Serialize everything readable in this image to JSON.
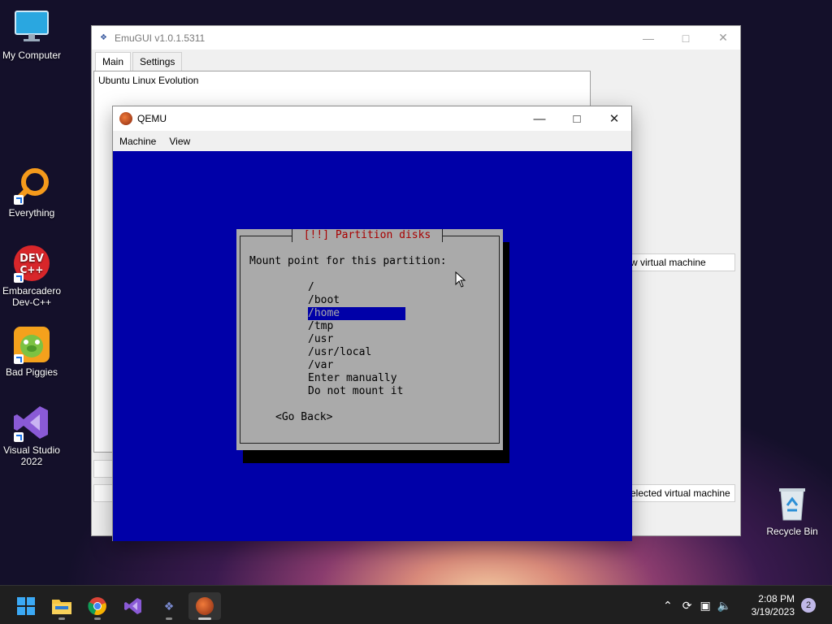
{
  "desktop": {
    "icons": [
      {
        "label": "My Computer"
      },
      {
        "label": "Everything"
      },
      {
        "label": "Embarcadero Dev-C++"
      },
      {
        "label": "Bad Piggies"
      },
      {
        "label": "Visual Studio 2022"
      },
      {
        "label": "Recycle Bin"
      }
    ]
  },
  "emugui": {
    "title": "EmuGUI v1.0.1.5311",
    "tabs": [
      "Main",
      "Settings"
    ],
    "vm_list": [
      "Ubuntu Linux Evolution"
    ],
    "buttons": {
      "new_vm": "w virtual machine",
      "selected_vm": "elected virtual machine"
    }
  },
  "qemu": {
    "title": "QEMU",
    "menu": [
      "Machine",
      "View"
    ],
    "installer": {
      "title": "[!!] Partition disks",
      "prompt": "Mount point for this partition:",
      "options": [
        "/",
        "/boot",
        "/home",
        "/tmp",
        "/usr",
        "/usr/local",
        "/var",
        "Enter manually",
        "Do not mount it"
      ],
      "selected_index": 2,
      "go_back": "<Go Back>"
    }
  },
  "taskbar": {
    "time": "2:08 PM",
    "date": "3/19/2023",
    "notification_count": "2"
  },
  "colors": {
    "installer_bg": "#0000a8",
    "dialog_bg": "#aaaaaa",
    "dialog_title": "#a80000"
  }
}
